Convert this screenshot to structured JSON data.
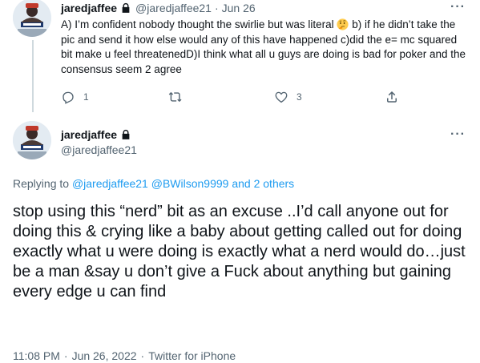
{
  "reply_tweet": {
    "display_name": "jaredjaffee",
    "handle": "@jaredjaffee21",
    "separator": "·",
    "date": "Jun 26",
    "text_before_emoji": "A) I’m confident nobody thought the swirlie but was literal ",
    "emoji": "thinking-face",
    "text_after_emoji": " b) if he didn’t take the pic and send it how else would any of this have happened c)did the e= mc squared bit make u feel threatenedD)I think what all u guys are doing is bad for poker  and the consensus seem 2 agree",
    "more_label": "···",
    "actions": {
      "reply_count": "1",
      "retweet_count": "",
      "like_count": "3"
    }
  },
  "main_tweet": {
    "display_name": "jaredjaffee",
    "handle": "@jaredjaffee21",
    "more_label": "···",
    "replying_prefix": "Replying to",
    "replying_user_1": "@jaredjaffee21",
    "replying_user_2": "@BWilson9999",
    "replying_and": "and",
    "replying_others": "2 others",
    "text": "stop using this “nerd” bit as an excuse ..I’d call anyone out for doing this & crying like a baby about getting called out for doing exactly what u were doing is exactly what a nerd would do…just be a man &say u don’t give a Fuck about anything but gaining every edge u can find",
    "time": "11:08 PM",
    "separator": "·",
    "date": "Jun 26, 2022",
    "source": "Twitter for iPhone"
  },
  "icons": {
    "lock": "lock-icon",
    "reply": "reply-icon",
    "retweet": "retweet-icon",
    "like": "heart-icon",
    "share": "share-icon",
    "more": "more-icon"
  },
  "colors": {
    "text": "#0f1419",
    "muted": "#536471",
    "link": "#1d9bf0",
    "thread_line": "#cfd9de"
  }
}
